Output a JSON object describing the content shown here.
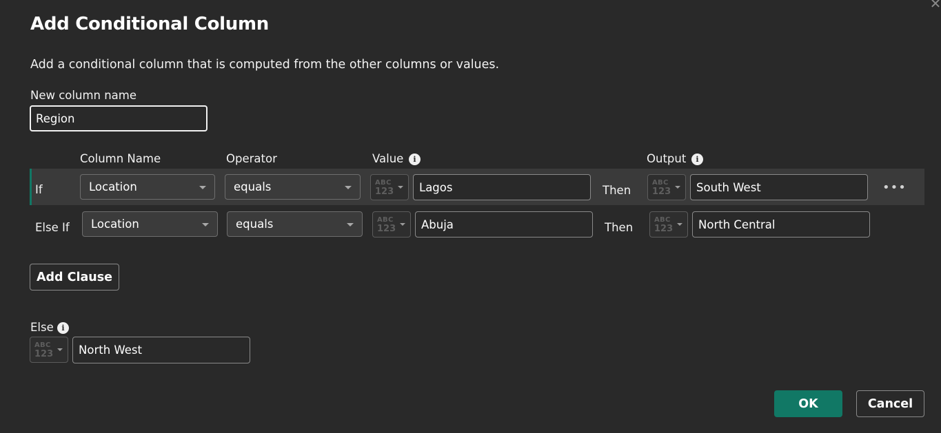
{
  "dialog": {
    "title": "Add Conditional Column",
    "close_glyph": "✕",
    "subtitle": "Add a conditional column that is computed from the other columns or values."
  },
  "new_column": {
    "label": "New column name",
    "value": "Region"
  },
  "headers": {
    "column_name": "Column Name",
    "operator": "Operator",
    "value": "Value",
    "output": "Output"
  },
  "type_icon": {
    "abc": "ABC",
    "num": "123"
  },
  "info_glyph": "i",
  "clauses": [
    {
      "keyword": "If",
      "column": "Location",
      "operator": "equals",
      "value": "Lagos",
      "then": "Then",
      "output": "South West"
    },
    {
      "keyword": "Else If",
      "column": "Location",
      "operator": "equals",
      "value": "Abuja",
      "then": "Then",
      "output": "North Central"
    }
  ],
  "more_glyph": "•••",
  "add_clause_label": "Add Clause",
  "else": {
    "label": "Else",
    "value": "North West"
  },
  "footer": {
    "ok_label": "OK",
    "cancel_label": "Cancel"
  },
  "colors": {
    "background": "#292929",
    "accent": "#117865",
    "selected_row": "#3a3a3a"
  }
}
